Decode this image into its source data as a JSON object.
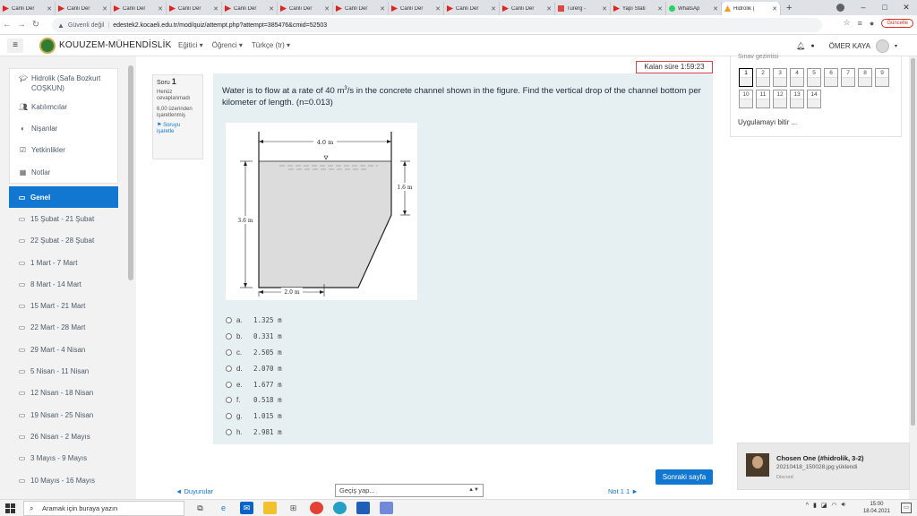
{
  "browser": {
    "tabs": [
      {
        "label": "Canlı Der",
        "icon": "youtube-icon"
      },
      {
        "label": "Canlı Der",
        "icon": "youtube-icon"
      },
      {
        "label": "Canlı Der",
        "icon": "youtube-icon"
      },
      {
        "label": "Canlı Der",
        "icon": "youtube-icon"
      },
      {
        "label": "Canlı Der",
        "icon": "youtube-icon"
      },
      {
        "label": "Canlı Der",
        "icon": "youtube-icon"
      },
      {
        "label": "Canlı Der",
        "icon": "youtube-icon"
      },
      {
        "label": "Canlı Der",
        "icon": "youtube-icon"
      },
      {
        "label": "Canlı Der",
        "icon": "youtube-icon"
      },
      {
        "label": "Canlı Der",
        "icon": "youtube-icon"
      },
      {
        "label": "Turerg -",
        "icon": "red-icon"
      },
      {
        "label": "Yapı Stati",
        "icon": "youtube-icon"
      },
      {
        "label": "WhatsAp",
        "icon": "whatsapp-icon"
      },
      {
        "label": "Hidrolik (",
        "icon": "moodle-icon"
      }
    ],
    "new_tab": "+",
    "insecure_label": "Güvenli değil",
    "url": "edestek2.kocaeli.edu.tr/mod/quiz/attempt.php?attempt=385476&cmid=52503",
    "update_label": "Güncelle"
  },
  "navbar": {
    "site_name": "KOUUZEM-MÜHENDİSLİK",
    "menu": [
      "Eğitici",
      "Öğrenci",
      "Türkçe (tr)"
    ],
    "user_name": "ÖMER KAYA"
  },
  "sidebar": {
    "course": "Hidrolik (Safa Bozkurt COŞKUN)",
    "items": [
      {
        "label": "Katılımcılar",
        "icon": "users-icon"
      },
      {
        "label": "Nişanlar",
        "icon": "badge-icon"
      },
      {
        "label": "Yetkinlikler",
        "icon": "check-icon"
      },
      {
        "label": "Notlar",
        "icon": "grades-icon"
      }
    ],
    "sections": [
      "Genel",
      "15 Şubat - 21 Şubat",
      "22 Şubat - 28 Şubat",
      "1 Mart - 7 Mart",
      "8 Mart - 14 Mart",
      "15 Mart - 21 Mart",
      "22 Mart - 28 Mart",
      "29 Mart - 4 Nisan",
      "5 Nisan - 11 Nisan",
      "12 Nisan - 18 Nisan",
      "19 Nisan - 25 Nisan",
      "26 Nisan - 2 Mayıs",
      "3 Mayıs - 9 Mayıs",
      "10 Mayıs - 16 Mayıs"
    ],
    "active_section": "Genel"
  },
  "question": {
    "label": "Soru",
    "number": "1",
    "state": "Henüz cevaplanmadı",
    "grade": "6,00 üzerinden işaretlenmiş",
    "flag_label": "Soruyu işaretle",
    "text_before": "Water is to flow at a rate of 40 m",
    "text_sup": "3",
    "text_after": "/s in the concrete channel shown in the figure. Find the vertical drop of the channel bottom per kilometer of length. (n=0.013)",
    "figure": {
      "top_width": "4.0 m",
      "side_height": "1.6 m",
      "total_height": "3.6 m",
      "bottom_width": "2.0 m"
    },
    "answers": [
      {
        "letter": "a.",
        "value": "1.325 m"
      },
      {
        "letter": "b.",
        "value": "0.331 m"
      },
      {
        "letter": "c.",
        "value": "2.505 m"
      },
      {
        "letter": "d.",
        "value": "2.070 m"
      },
      {
        "letter": "e.",
        "value": "1.677 m"
      },
      {
        "letter": "f.",
        "value": "0.518 m"
      },
      {
        "letter": "g.",
        "value": "1.015 m"
      },
      {
        "letter": "h.",
        "value": "2.981 m"
      }
    ]
  },
  "timer": {
    "label": "Kalan süre 1:59:23"
  },
  "quiz_nav": {
    "title": "Sınav gezintisi",
    "buttons": [
      "1",
      "2",
      "3",
      "4",
      "5",
      "6",
      "7",
      "8",
      "9",
      "10",
      "11",
      "12",
      "13",
      "14"
    ],
    "current": "1",
    "finish_label": "Uygulamayı bitir ..."
  },
  "footer": {
    "next_button": "Sonraki sayfa",
    "prev_link": "◄ Duyurular",
    "jump_select": "Geçiş yap...",
    "next_link": "Not 1 1 ►"
  },
  "toast": {
    "title": "Chosen One (#hidrolik, 3-2)",
    "message": "20210418_150028.jpg yüklendi",
    "app": "Discord"
  },
  "taskbar": {
    "search_placeholder": "Aramak için buraya yazın",
    "time": "15:00",
    "date": "18.04.2021"
  }
}
